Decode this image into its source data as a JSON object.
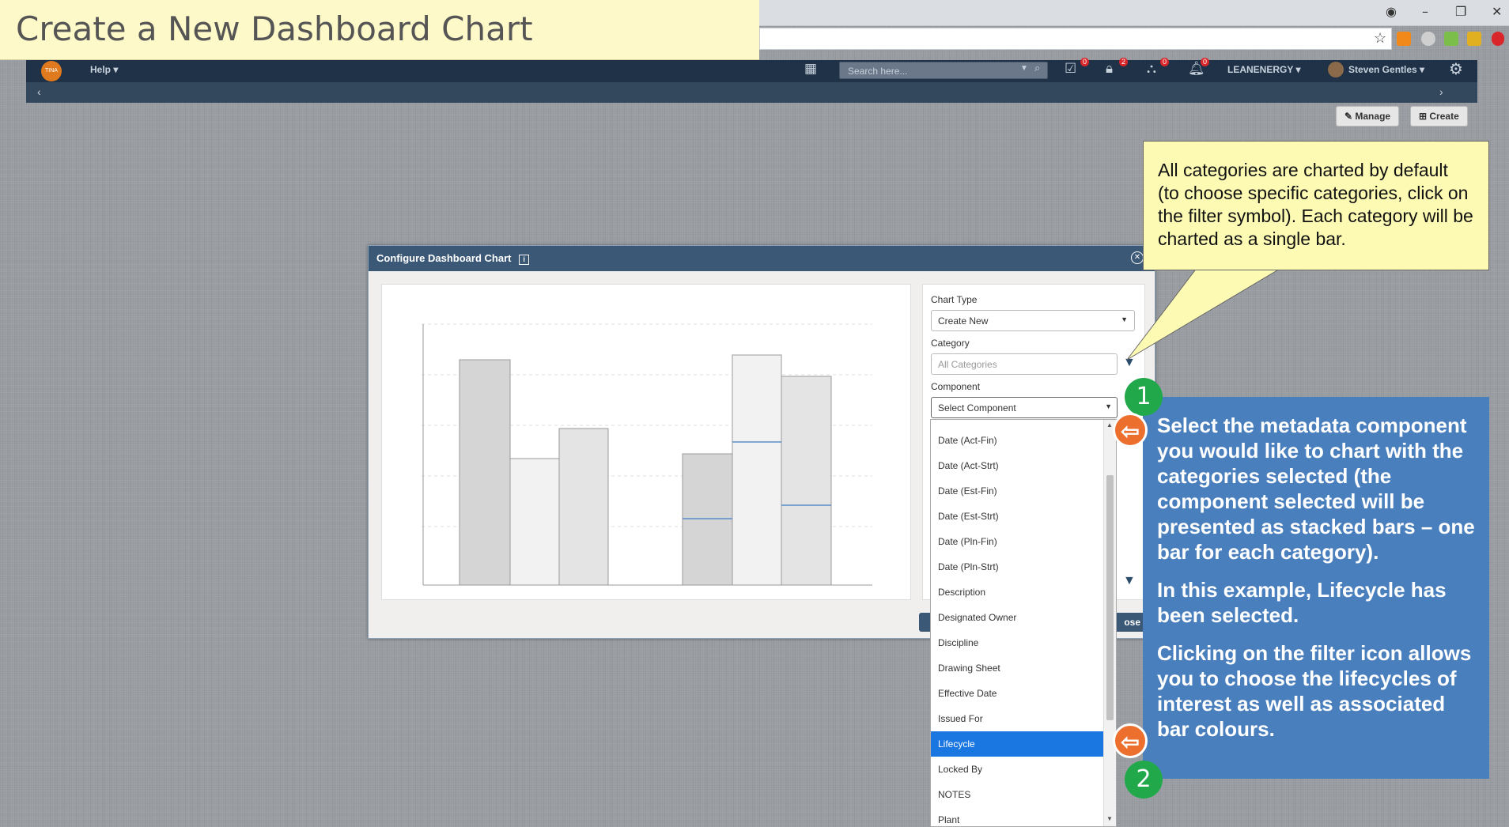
{
  "banner": {
    "title": "Create a New Dashboard Chart"
  },
  "nav": {
    "help": "Help ▾",
    "search_placeholder": "Search here...",
    "badges": [
      "0",
      "2",
      "0",
      "0"
    ],
    "company": "LEANENERGY ▾",
    "user": "Steven Gentles ▾",
    "logo_text": "TINA"
  },
  "toolbar": {
    "manage": "Manage",
    "create": "Create"
  },
  "dialog": {
    "title": "Configure Dashboard Chart",
    "chart_type_label": "Chart Type",
    "chart_type_value": "Create New",
    "category_label": "Category",
    "category_placeholder": "All Categories",
    "component_label": "Component",
    "component_value": "Select Component",
    "close_label": "ose"
  },
  "dropdown": {
    "options": [
      "Date (Act-Fin)",
      "Date (Act-Strt)",
      "Date (Est-Fin)",
      "Date (Est-Strt)",
      "Date (Pln-Fin)",
      "Date (Pln-Strt)",
      "Description",
      "Designated Owner",
      "Discipline",
      "Drawing Sheet",
      "Effective Date",
      "Issued For",
      "Lifecycle",
      "Locked By",
      "NOTES",
      "Plant"
    ],
    "selected": "Lifecycle"
  },
  "callout_yellow": {
    "text": "All categories are charted by default (to choose specific categories, click on the filter symbol). Each category will be charted as a single bar."
  },
  "callout_blue": {
    "p1": "Select the metadata component you would like to chart with the categories selected (the component selected will be presented as stacked bars – one bar for each category).",
    "p2": "In this example, Lifecycle has been selected.",
    "p3": "Clicking on the filter icon allows you to choose the lifecycles of interest as well as associated bar colours."
  },
  "steps": [
    "1",
    "2"
  ],
  "colors": {
    "navbar": "#1f3247",
    "dialog_header": "#3b5877",
    "selected_option": "#1a76e0",
    "callout_blue": "#4a7fbe",
    "callout_yellow": "#fdfbb3",
    "step_green": "#20a84a",
    "arrow_orange": "#ed6f2d"
  }
}
